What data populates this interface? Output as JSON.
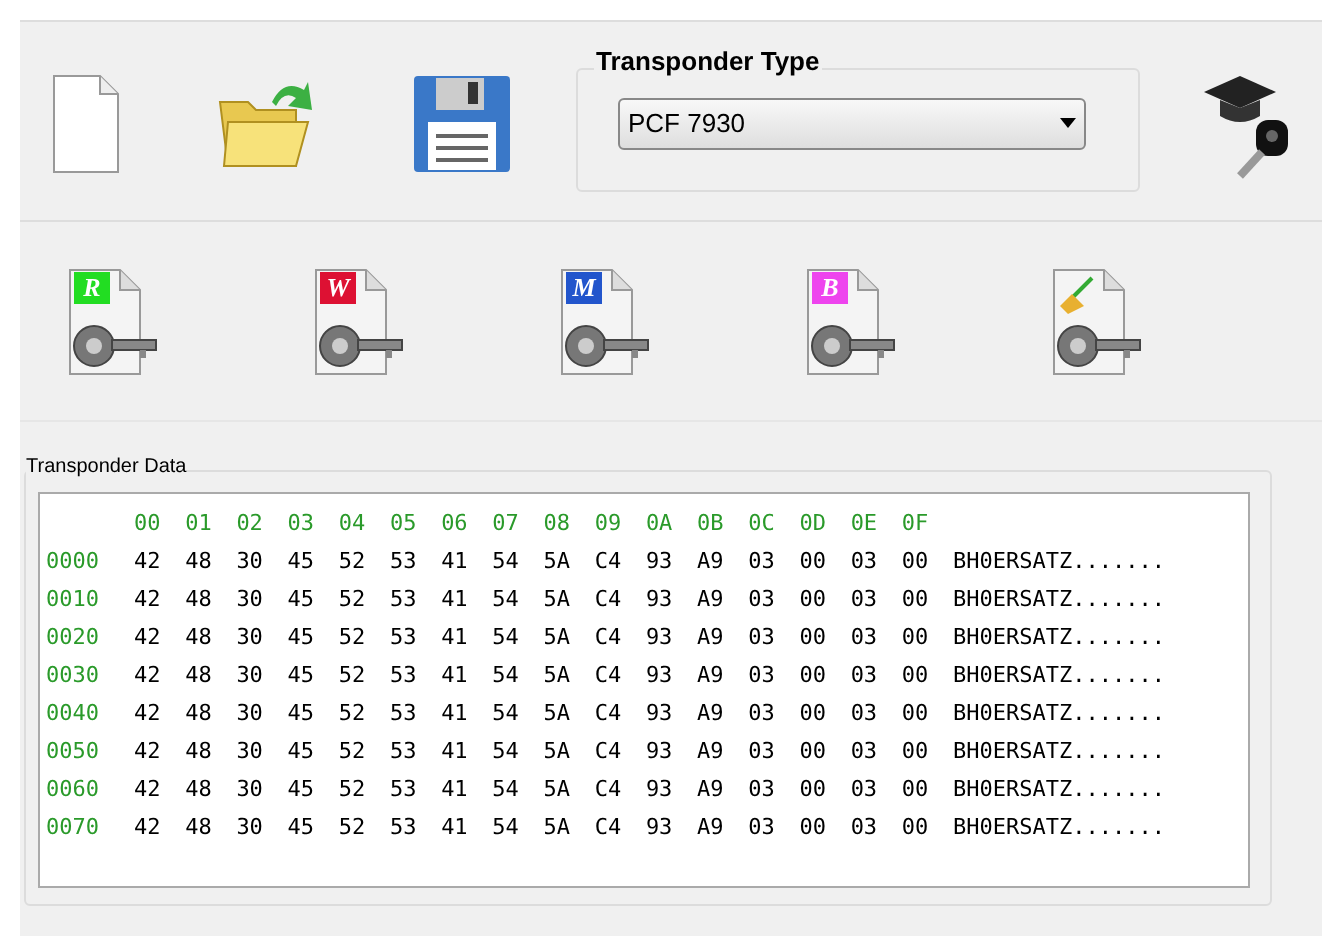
{
  "toolbar": {
    "transponder_type": {
      "label": "Transponder Type",
      "value": "PCF 7930"
    }
  },
  "key_actions": [
    {
      "kind": "letter",
      "letter": "R",
      "color": "#22dd22"
    },
    {
      "kind": "letter",
      "letter": "W",
      "color": "#dd1133"
    },
    {
      "kind": "letter",
      "letter": "M",
      "color": "#2255cc"
    },
    {
      "kind": "letter",
      "letter": "B",
      "color": "#ee44ee"
    },
    {
      "kind": "broom"
    }
  ],
  "transponder_data": {
    "label": "Transponder Data",
    "columns": [
      "00",
      "01",
      "02",
      "03",
      "04",
      "05",
      "06",
      "07",
      "08",
      "09",
      "0A",
      "0B",
      "0C",
      "0D",
      "0E",
      "0F"
    ],
    "rows": [
      {
        "address": "0000",
        "bytes": [
          "42",
          "48",
          "30",
          "45",
          "52",
          "53",
          "41",
          "54",
          "5A",
          "C4",
          "93",
          "A9",
          "03",
          "00",
          "03",
          "00"
        ],
        "ascii": "BH0ERSATZ......."
      },
      {
        "address": "0010",
        "bytes": [
          "42",
          "48",
          "30",
          "45",
          "52",
          "53",
          "41",
          "54",
          "5A",
          "C4",
          "93",
          "A9",
          "03",
          "00",
          "03",
          "00"
        ],
        "ascii": "BH0ERSATZ......."
      },
      {
        "address": "0020",
        "bytes": [
          "42",
          "48",
          "30",
          "45",
          "52",
          "53",
          "41",
          "54",
          "5A",
          "C4",
          "93",
          "A9",
          "03",
          "00",
          "03",
          "00"
        ],
        "ascii": "BH0ERSATZ......."
      },
      {
        "address": "0030",
        "bytes": [
          "42",
          "48",
          "30",
          "45",
          "52",
          "53",
          "41",
          "54",
          "5A",
          "C4",
          "93",
          "A9",
          "03",
          "00",
          "03",
          "00"
        ],
        "ascii": "BH0ERSATZ......."
      },
      {
        "address": "0040",
        "bytes": [
          "42",
          "48",
          "30",
          "45",
          "52",
          "53",
          "41",
          "54",
          "5A",
          "C4",
          "93",
          "A9",
          "03",
          "00",
          "03",
          "00"
        ],
        "ascii": "BH0ERSATZ......."
      },
      {
        "address": "0050",
        "bytes": [
          "42",
          "48",
          "30",
          "45",
          "52",
          "53",
          "41",
          "54",
          "5A",
          "C4",
          "93",
          "A9",
          "03",
          "00",
          "03",
          "00"
        ],
        "ascii": "BH0ERSATZ......."
      },
      {
        "address": "0060",
        "bytes": [
          "42",
          "48",
          "30",
          "45",
          "52",
          "53",
          "41",
          "54",
          "5A",
          "C4",
          "93",
          "A9",
          "03",
          "00",
          "03",
          "00"
        ],
        "ascii": "BH0ERSATZ......."
      },
      {
        "address": "0070",
        "bytes": [
          "42",
          "48",
          "30",
          "45",
          "52",
          "53",
          "41",
          "54",
          "5A",
          "C4",
          "93",
          "A9",
          "03",
          "00",
          "03",
          "00"
        ],
        "ascii": "BH0ERSATZ......."
      }
    ]
  }
}
